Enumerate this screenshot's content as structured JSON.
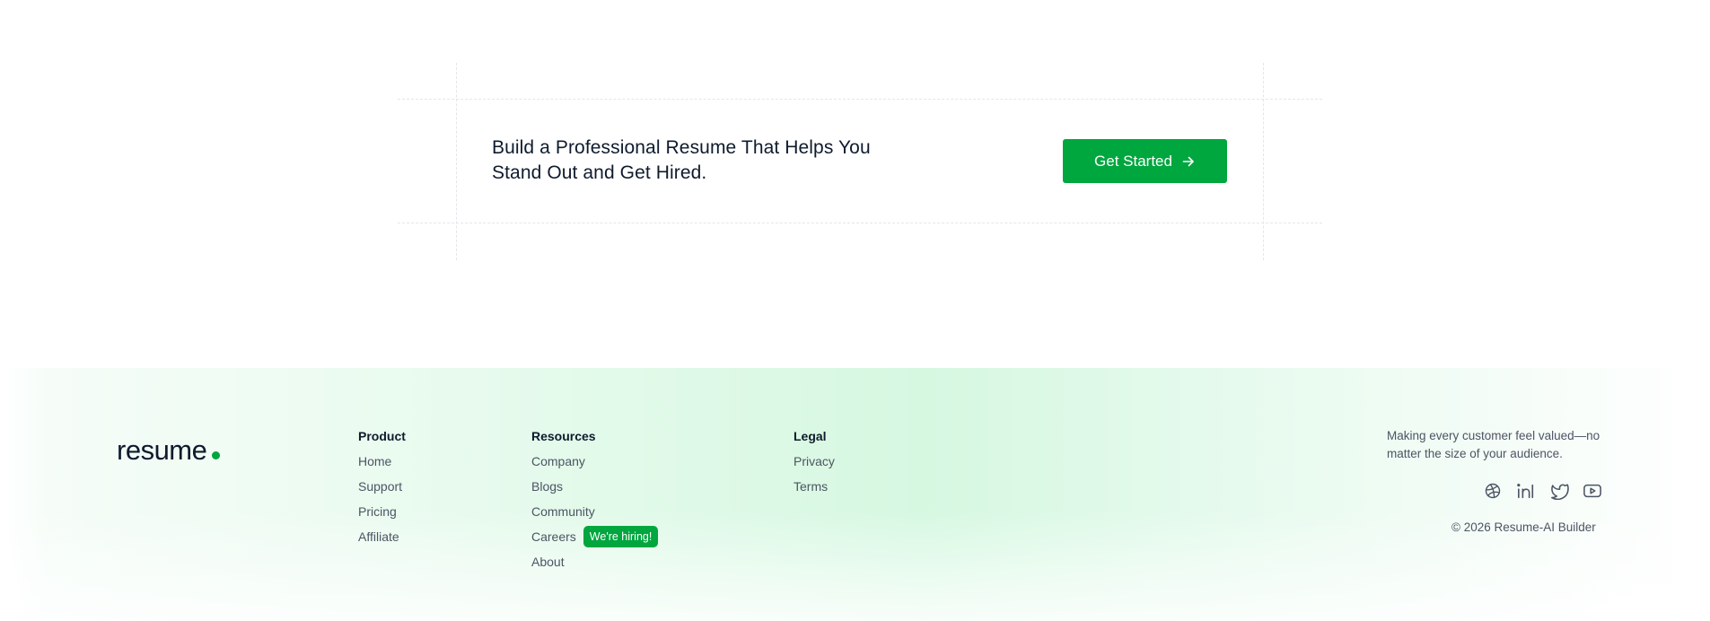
{
  "cta": {
    "headline": "Build a Professional Resume That Helps You Stand Out and Get Hired.",
    "button_label": "Get Started"
  },
  "footer": {
    "logo_text": "resume",
    "columns": [
      {
        "title": "Product",
        "links": [
          "Home",
          "Support",
          "Pricing",
          "Affiliate"
        ]
      },
      {
        "title": "Resources",
        "links": [
          "Company",
          "Blogs",
          "Community",
          "Careers",
          "About"
        ],
        "badge": "We're hiring!"
      },
      {
        "title": "Legal",
        "links": [
          "Privacy",
          "Terms"
        ]
      }
    ],
    "tagline": "Making every customer feel valued—no matter the size of your audience.",
    "socials": [
      "dribbble-icon",
      "linkedin-icon",
      "twitter-icon",
      "youtube-icon"
    ],
    "copyright": "© 2026 Resume-AI Builder"
  },
  "colors": {
    "accent": "#00a63e",
    "text_dark": "#0f1b2d",
    "text_muted": "#4b5563"
  }
}
